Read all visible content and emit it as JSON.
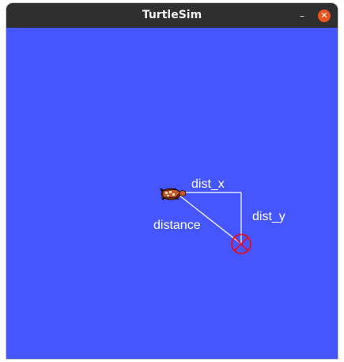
{
  "window": {
    "title": "TurtleSim",
    "minimize_glyph": "–",
    "close_glyph": "✕",
    "close_color": "#e95420",
    "background_color": "#4556ff"
  },
  "canvas": {
    "labels": {
      "dist_x": "dist_x",
      "dist_y": "dist_y",
      "distance": "distance"
    },
    "turtle_icon": "turtle-icon",
    "target_icon": "crosshair-circle-icon",
    "target_color": "#ff0000",
    "line_color": "#ffffff"
  }
}
